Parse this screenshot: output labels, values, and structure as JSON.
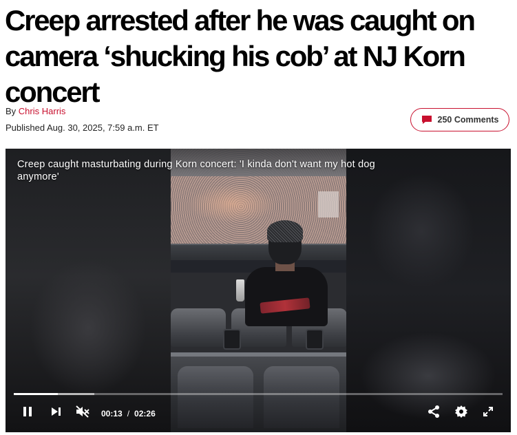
{
  "article": {
    "headline": "Creep arrested after he was caught on camera ‘shucking his cob’ at NJ Korn concert",
    "byline_prefix": "By",
    "author": "Chris Harris",
    "published": "Published Aug. 30, 2025, 7:59 a.m. ET",
    "comments_label": "250 Comments"
  },
  "video": {
    "title": "Creep caught masturbating during Korn concert: 'I kinda don't want my hot dog anymore'",
    "current_time": "00:13",
    "time_separator": "/",
    "duration": "02:26",
    "progress_fraction": 0.09,
    "buffered_fraction": 0.165,
    "muted": true
  },
  "icons": {
    "comments": "comment-bubble-icon",
    "pause": "pause-icon",
    "next": "skip-next-icon",
    "mute": "volume-muted-icon",
    "share": "share-icon",
    "settings": "gear-icon",
    "fullscreen": "fullscreen-icon"
  },
  "colors": {
    "accent": "#c8102e",
    "video_bg": "#0b0b0c",
    "controls": "#ffffff"
  }
}
